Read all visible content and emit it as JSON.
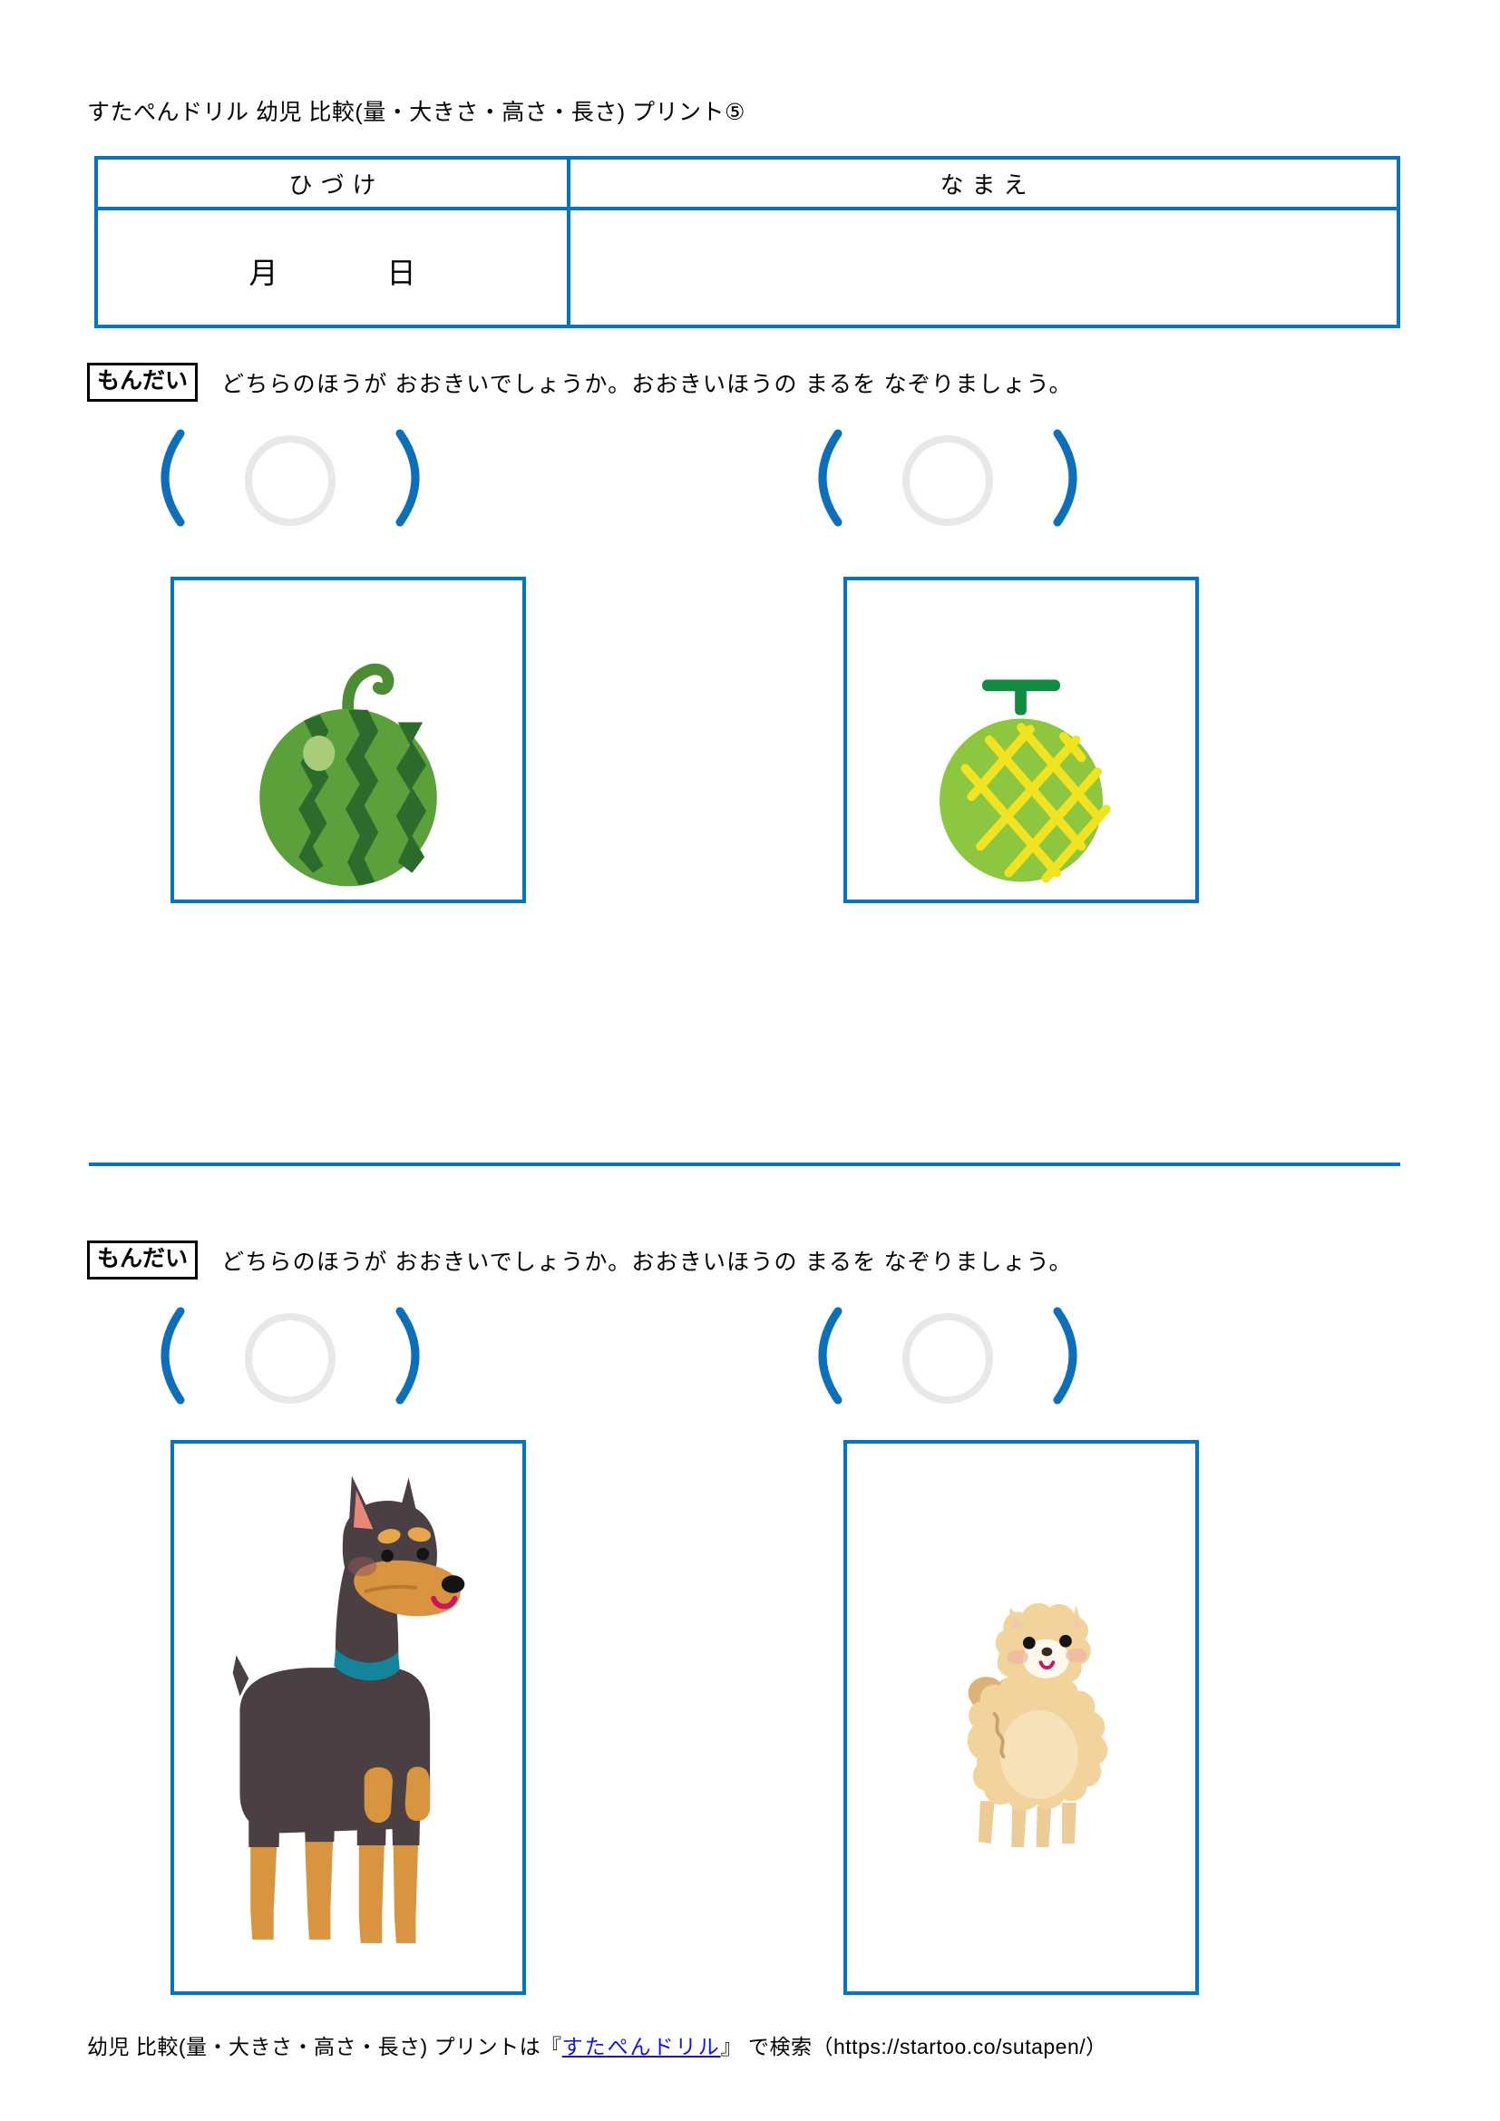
{
  "header": {
    "title": "すたぺんドリル 幼児 比較(量・大きさ・高さ・長さ) プリント⑤"
  },
  "info_table": {
    "date_header": "ひづけ",
    "name_header": "なまえ",
    "month_label": "月",
    "day_label": "日",
    "name_value": ""
  },
  "problems": [
    {
      "badge": "もんだい",
      "prompt": "どちらのほうが おおきいでしょうか。おおきいほうの まるを なぞりましょう。",
      "left_item": "watermelon",
      "right_item": "melon",
      "left_answer": "",
      "right_answer": ""
    },
    {
      "badge": "もんだい",
      "prompt": "どちらのほうが おおきいでしょうか。おおきいほうの まるを なぞりましょう。",
      "left_item": "doberman-dog",
      "right_item": "pomeranian-dog",
      "left_answer": "",
      "right_answer": ""
    }
  ],
  "footer": {
    "text_before": "幼児 比較(量・大きさ・高さ・長さ) プリントは『",
    "link_text": "すたぺんドリル",
    "text_after": "』 で検索（https://startoo.co/sutapen/）"
  },
  "colors": {
    "frame_blue": "#0274c4",
    "bracket_blue": "#0c6fba",
    "trace_circle_gray": "#e8e8e8",
    "link_blue": "#1414d8",
    "watermelon_light": "#5ca03c",
    "watermelon_dark": "#2d6b2d",
    "melon_body": "#8dc63f",
    "melon_net": "#f2e320",
    "doberman_body": "#4a3f42",
    "doberman_tan": "#d9943f",
    "pomeranian_body": "#f2d39b"
  }
}
